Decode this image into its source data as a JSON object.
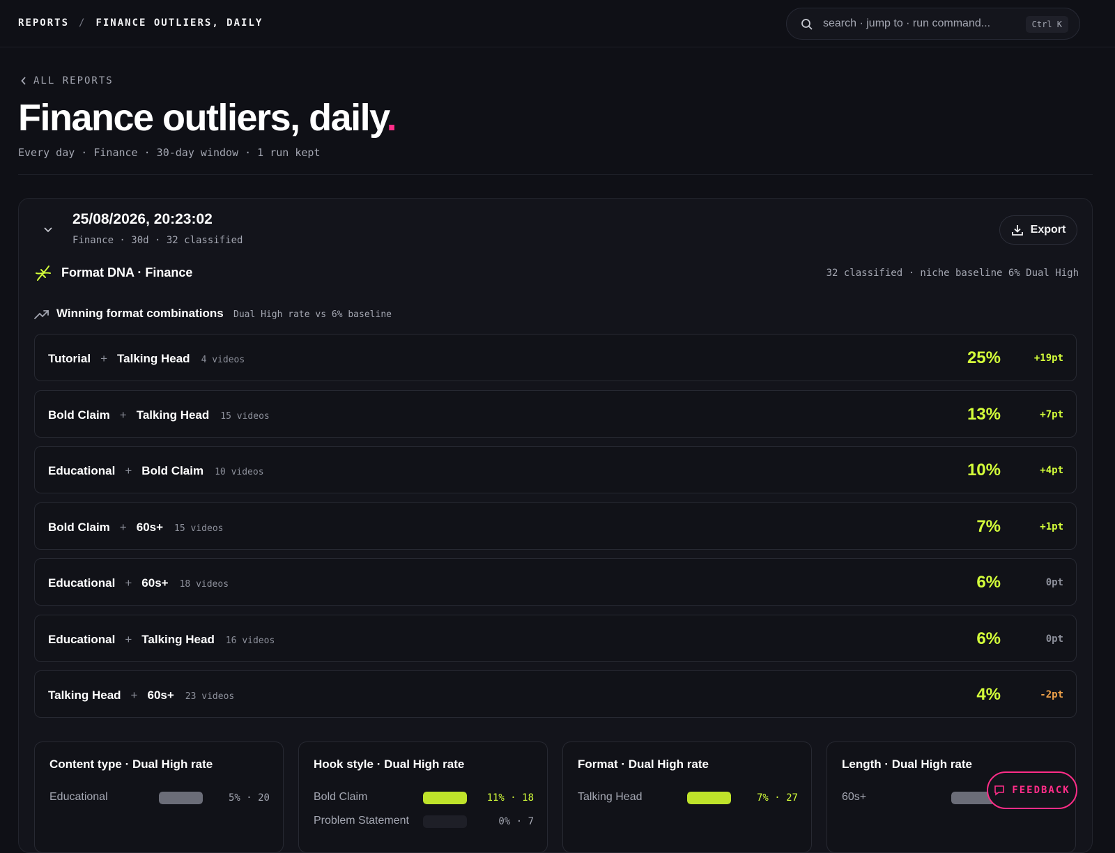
{
  "breadcrumb": {
    "root": "REPORTS",
    "sep": "/",
    "current": "FINANCE OUTLIERS, DAILY"
  },
  "search": {
    "placeholder": "search · jump to · run command...",
    "shortcut": "Ctrl K"
  },
  "back": {
    "label": "ALL REPORTS"
  },
  "page": {
    "title": "Finance outliers, daily",
    "title_dot": ".",
    "subtitle": "Every day · Finance · 30-day window · 1 run kept"
  },
  "run": {
    "timestamp": "25/08/2026, 20:23:02",
    "meta": "Finance · 30d · 32 classified",
    "export_label": "Export"
  },
  "format_dna": {
    "title": "Format DNA · Finance",
    "meta": "32 classified · niche baseline 6% Dual High"
  },
  "winning": {
    "title": "Winning format combinations",
    "note": "Dual High rate vs 6% baseline",
    "rows": [
      {
        "a": "Tutorial",
        "b": "Talking Head",
        "videos": "4 videos",
        "rate": "25%",
        "delta": "+19pt",
        "trend": "pos"
      },
      {
        "a": "Bold Claim",
        "b": "Talking Head",
        "videos": "15 videos",
        "rate": "13%",
        "delta": "+7pt",
        "trend": "pos"
      },
      {
        "a": "Educational",
        "b": "Bold Claim",
        "videos": "10 videos",
        "rate": "10%",
        "delta": "+4pt",
        "trend": "pos"
      },
      {
        "a": "Bold Claim",
        "b": "60s+",
        "videos": "15 videos",
        "rate": "7%",
        "delta": "+1pt",
        "trend": "pos"
      },
      {
        "a": "Educational",
        "b": "60s+",
        "videos": "18 videos",
        "rate": "6%",
        "delta": "0pt",
        "trend": "zero"
      },
      {
        "a": "Educational",
        "b": "Talking Head",
        "videos": "16 videos",
        "rate": "6%",
        "delta": "0pt",
        "trend": "zero"
      },
      {
        "a": "Talking Head",
        "b": "60s+",
        "videos": "23 videos",
        "rate": "4%",
        "delta": "-2pt",
        "trend": "neg"
      }
    ]
  },
  "cards": [
    {
      "title": "Content type · Dual High rate",
      "rows": [
        {
          "label": "Educational",
          "value": "5% · 20",
          "fill": 1.0,
          "color": "#6b6d78",
          "text_color": "#a4a7b2"
        }
      ]
    },
    {
      "title": "Hook style · Dual High rate",
      "rows": [
        {
          "label": "Bold Claim",
          "value": "11% · 18",
          "fill": 1.0,
          "color": "#bfe32a",
          "text_color": "#d4ff3a"
        },
        {
          "label": "Problem Statement",
          "value": "0% · 7",
          "fill": 0.0,
          "color": "#1e1f27",
          "text_color": "#a4a7b2"
        }
      ]
    },
    {
      "title": "Format · Dual High rate",
      "rows": [
        {
          "label": "Talking Head",
          "value": "7% · 27",
          "fill": 1.0,
          "color": "#bfe32a",
          "text_color": "#d4ff3a"
        }
      ]
    },
    {
      "title": "Length · Dual High rate",
      "rows": [
        {
          "label": "60s+",
          "value": "",
          "fill": 1.0,
          "color": "#6b6d78",
          "text_color": "#a4a7b2"
        }
      ]
    }
  ],
  "feedback": {
    "label": "FEEDBACK"
  },
  "colors": {
    "accent": "#d4ff3a",
    "brand_pink": "#ff2d88",
    "negative": "#f0a24a"
  }
}
